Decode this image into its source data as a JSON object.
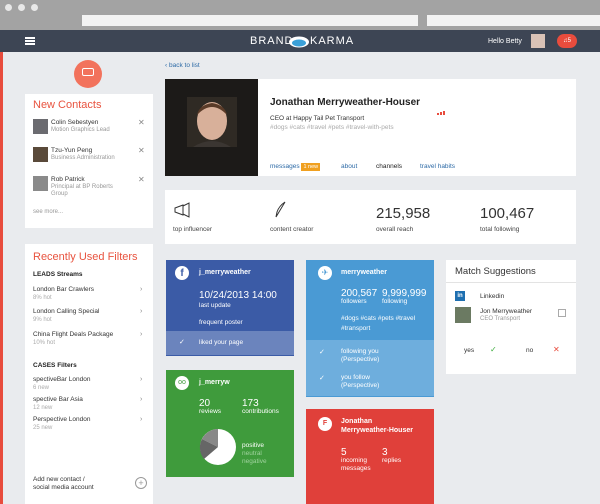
{
  "brand": {
    "left": "BRAND",
    "right": "KARMA"
  },
  "user": {
    "greeting": "Hello Betty",
    "notif_count": "5"
  },
  "profile": {
    "back": "back to list",
    "name": "Jonathan Merryweather-Houser",
    "title": "CEO at Happy Tail Pet Transport",
    "hashtags": "#dogs #cats #travel #pets #travel-with-pets",
    "tabs": [
      {
        "label": "messages",
        "badge": "1 new"
      },
      {
        "label": "about"
      },
      {
        "label": "channels"
      },
      {
        "label": "travel habits"
      }
    ]
  },
  "stats": [
    {
      "label": "top influencer"
    },
    {
      "label": "content creator"
    },
    {
      "value": "215,958",
      "label": "overall reach"
    },
    {
      "value": "100,467",
      "label": "total following"
    }
  ],
  "new_contacts": {
    "title": "New Contacts",
    "items": [
      {
        "name": "Colin Sebestyen",
        "role": "Motion Graphics Lead"
      },
      {
        "name": "Tzu-Yun Peng",
        "role": "Business Administration"
      },
      {
        "name": "Rob Patrick",
        "role": "Principal at BP Roberts",
        "role2": "Group"
      }
    ],
    "see_more": "see more..."
  },
  "filters": {
    "title": "Recently Used Filters",
    "leads_title": "LEADS Streams",
    "leads": [
      {
        "name": "London Bar Crawlers",
        "sub": "8% hot"
      },
      {
        "name": "London Calling Special",
        "sub": "9% hot"
      },
      {
        "name": "China Flight Deals Package",
        "sub": "10% hot"
      }
    ],
    "cases_title": "CASES Filters",
    "cases": [
      {
        "name": "spectiveBar London",
        "sub": "6 new"
      },
      {
        "name": "spective Bar Asia",
        "sub": "12 new"
      },
      {
        "name": "Perspective London",
        "sub": "25 new"
      }
    ]
  },
  "add_contact": {
    "line1": "Add new contact /",
    "line2": "social media account"
  },
  "facebook": {
    "handle": "j_merryweather",
    "date": "10/24/2013 14:00",
    "date_label": "last update",
    "tag": "frequent poster",
    "liked": "liked your page",
    "color": "#3b5ba6"
  },
  "twitter": {
    "handle": "merryweather",
    "followers": "200,567",
    "followers_label": "followers",
    "following": "9,999,999",
    "following_label": "following",
    "tags": "#dogs #cats #pets #travel #transport",
    "check1a": "following you",
    "check1b": "(Perspective)",
    "check2a": "you follow",
    "check2b": "(Perspective)",
    "color": "#4a9ad4"
  },
  "tripadvisor": {
    "handle": "j_merryw",
    "reviews": "20",
    "reviews_label": "reviews",
    "contrib": "173",
    "contrib_label": "contributions",
    "positive": "positive",
    "neutral": "neutral",
    "negative": "negative",
    "color": "#3f9b3c"
  },
  "foursquare": {
    "name1": "Jonathan",
    "name2": "Merryweather-Houser",
    "incoming": "5",
    "incoming_l1": "incoming",
    "incoming_l2": "messages",
    "replies": "3",
    "replies_label": "replies",
    "color": "#e0403a"
  },
  "match": {
    "title": "Match Suggestions",
    "source": "Linkedin",
    "name": "Jon Merryweather",
    "role": "CEO Transport",
    "yes": "yes",
    "no": "no"
  }
}
